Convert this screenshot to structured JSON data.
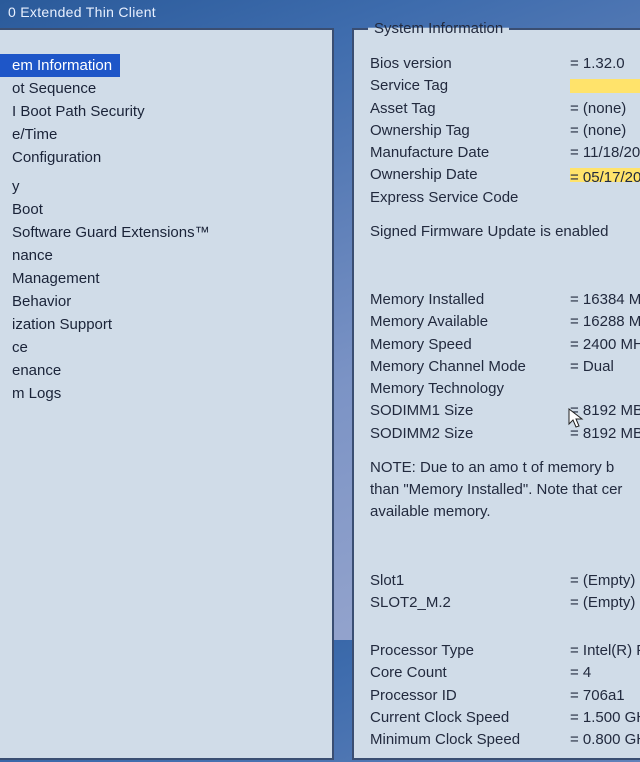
{
  "title": "0 Extended Thin Client",
  "legend_right": "System Information",
  "nav": {
    "items": [
      "em Information",
      "ot Sequence",
      "I Boot Path Security",
      "e/Time",
      " Configuration",
      "",
      "y",
      " Boot",
      "Software Guard Extensions™",
      "nance",
      " Management",
      "Behavior",
      "ization Support",
      "ce",
      "enance",
      "m Logs"
    ],
    "selected_index": 0
  },
  "info": {
    "bios_version": {
      "label": "Bios version",
      "value": "= 1.32.0"
    },
    "service_tag": {
      "label": "Service Tag",
      "value_highlighted": true
    },
    "asset_tag": {
      "label": "Asset Tag",
      "value": "= (none)"
    },
    "ownership_tag": {
      "label": "Ownership Tag",
      "value": "= (none)"
    },
    "manufacture_date": {
      "label": "Manufacture Date",
      "value": "= 11/18/20"
    },
    "ownership_date": {
      "label": "Ownership Date",
      "value": "= 05/17/20"
    },
    "express_service_code": {
      "label": "Express Service Code"
    },
    "signed_fw": "Signed Firmware Update is enabled",
    "mem_installed": {
      "label": "Memory Installed",
      "value": "= 16384 M"
    },
    "mem_available": {
      "label": "Memory Available",
      "value": "= 16288 M"
    },
    "mem_speed": {
      "label": "Memory Speed",
      "value": "= 2400 MH"
    },
    "mem_channel": {
      "label": "Memory Channel Mode",
      "value": "= Dual"
    },
    "mem_tech": {
      "label": "Memory Technology"
    },
    "sodimm1": {
      "label": "SODIMM1 Size",
      "value": "= 8192 MB"
    },
    "sodimm2": {
      "label": "SODIMM2 Size",
      "value": "= 8192 MB"
    },
    "note_line1": "NOTE: Due to an amo    t of memory b",
    "note_line2": "than \"Memory Installed\". Note that cer",
    "note_line3": "available memory.",
    "slot1": {
      "label": "Slot1",
      "value": "= (Empty)"
    },
    "slot2": {
      "label": "SLOT2_M.2",
      "value": "= (Empty)"
    },
    "cpu_type": {
      "label": "Processor Type",
      "value": "= Intel(R) Pe"
    },
    "core_count": {
      "label": "Core Count",
      "value": "= 4"
    },
    "cpu_id": {
      "label": "Processor ID",
      "value": "= 706a1"
    },
    "cur_clock": {
      "label": "Current Clock Speed",
      "value": "= 1.500 GH"
    },
    "min_clock": {
      "label": "Minimum Clock Speed",
      "value": "= 0.800 GH"
    }
  }
}
